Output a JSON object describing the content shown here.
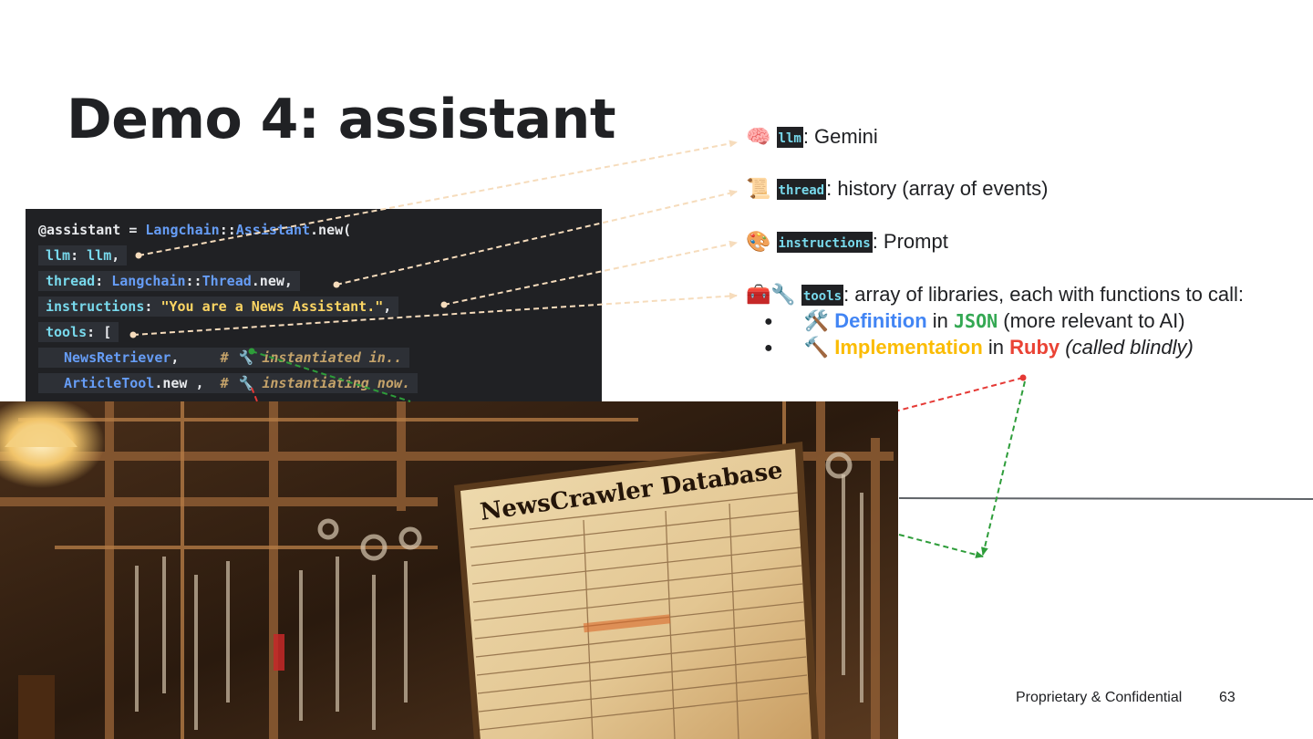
{
  "slide": {
    "title": "Demo 4: assistant",
    "footer_text": "Proprietary & Confidential",
    "page_number": "63"
  },
  "code": {
    "line1": {
      "a": "@assistant",
      "b": " = ",
      "c": "Langchain",
      "d": "::",
      "e": "Assistant",
      "f": ".new("
    },
    "line2": {
      "a": "llm",
      "b": ": ",
      "c": "llm",
      "d": ","
    },
    "line3": {
      "a": "thread",
      "b": ": ",
      "c": "Langchain",
      "d": "::",
      "e": "Thread",
      "f": ".new",
      "g": ","
    },
    "line4": {
      "a": "instructions",
      "b": ": ",
      "c": "\"You are a News Assistant.\"",
      "d": ","
    },
    "line5": {
      "a": "tools",
      "b": ": ["
    },
    "line6": {
      "a": "NewsRetriever",
      "b": ",     ",
      "c": "# 🔧 instantiated in.."
    },
    "line7": {
      "a": "ArticleTool",
      "b": ".new",
      "c": " ,  ",
      "d": "# 🔧 instantiating now."
    }
  },
  "photo": {
    "sign_text": "NewsCrawler Database"
  },
  "legend": {
    "llm": {
      "icon": "🧠",
      "tag": "llm",
      "text": ": Gemini"
    },
    "thread": {
      "icon": "📜",
      "tag": "thread",
      "text": ": history (array of events)"
    },
    "instructions": {
      "icon": "🎨",
      "tag": "instructions",
      "text": ": Prompt"
    },
    "tools": {
      "icon": "🧰🔧",
      "tag": "tools",
      "text": ": array of libraries, each with functions to call:"
    },
    "bullets": [
      {
        "bullet": "●",
        "icon": "🛠️",
        "strong": "Definition",
        "mid": " in ",
        "code": "JSON",
        "rest": " (more relevant to AI)"
      },
      {
        "bullet": "●",
        "icon": "🔨",
        "strong": "Implementation",
        "mid": " in ",
        "lang": "Ruby",
        "rest": "(called blindly)"
      }
    ]
  },
  "colors": {
    "connector_light": "#f6dcbc",
    "connector_red": "#e53935",
    "connector_green": "#2e9d3a",
    "code_bg": "#202124"
  }
}
